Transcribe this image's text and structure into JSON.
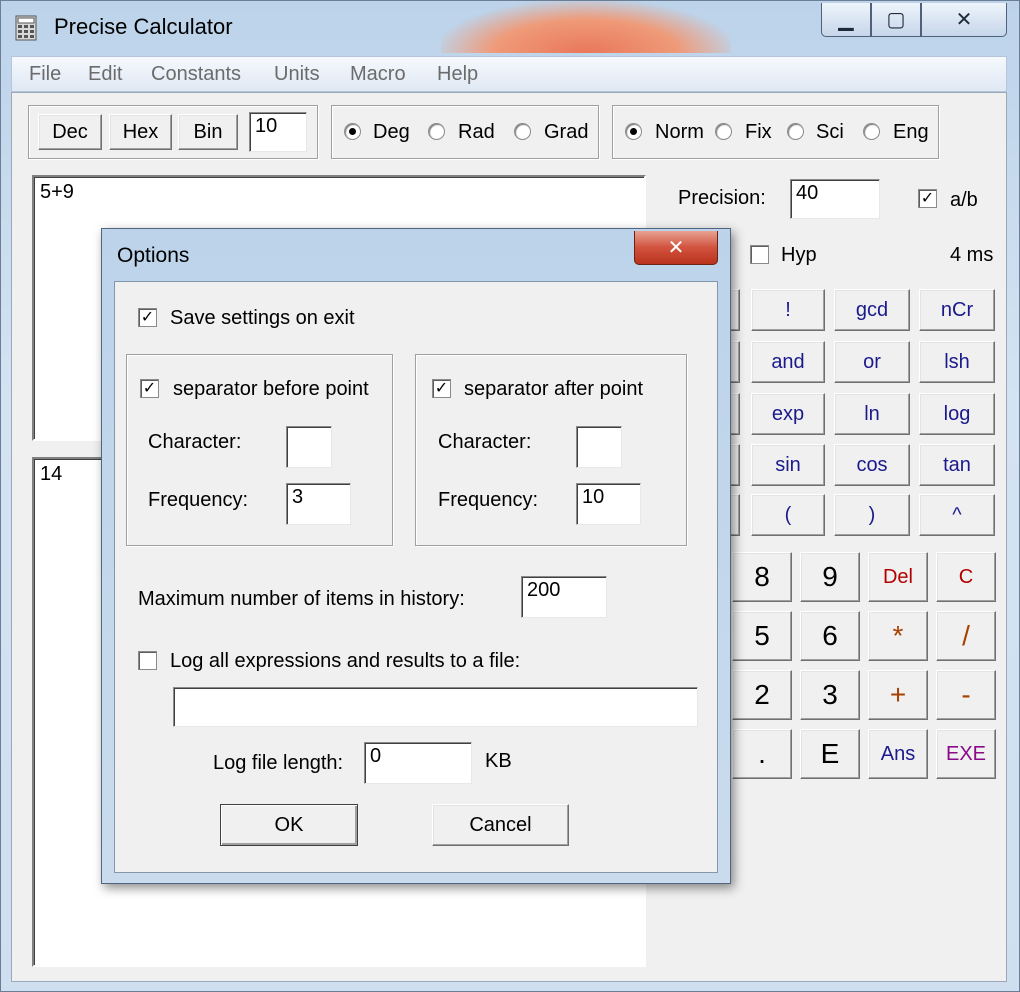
{
  "window": {
    "title": "Precise Calculator"
  },
  "caption": {
    "minimize": "▁",
    "maximize": "▢",
    "close": "✕"
  },
  "menu": [
    "File",
    "Edit",
    "Constants",
    "Units",
    "Macro",
    "Help"
  ],
  "base": {
    "dec": "Dec",
    "hex": "Hex",
    "bin": "Bin",
    "value": "10"
  },
  "angle": [
    {
      "label": "Deg",
      "selected": true
    },
    {
      "label": "Rad",
      "selected": false
    },
    {
      "label": "Grad",
      "selected": false
    }
  ],
  "format": [
    {
      "label": "Norm",
      "selected": true
    },
    {
      "label": "Fix",
      "selected": false
    },
    {
      "label": "Sci",
      "selected": false
    },
    {
      "label": "Eng",
      "selected": false
    }
  ],
  "precision": {
    "label": "Precision:",
    "value": "40"
  },
  "fraction": {
    "label": "a/b",
    "checked": true
  },
  "hyp": {
    "label": "Hyp",
    "checked": false
  },
  "timing": "4 ms",
  "expression": "5+9",
  "result": "14",
  "function_buttons": [
    "!",
    "gcd",
    "nCr",
    "and",
    "or",
    "lsh",
    "exp",
    "ln",
    "log",
    "sin",
    "cos",
    "tan",
    "(",
    ")",
    "^"
  ],
  "keypad": [
    "8",
    "9",
    "Del",
    "C",
    "5",
    "6",
    "*",
    "/",
    "2",
    "3",
    "+",
    "-",
    ".",
    "E",
    "Ans",
    "EXE"
  ],
  "dialog": {
    "title": "Options",
    "close": "✕",
    "save_settings": {
      "label": "Save settings on exit",
      "checked": true
    },
    "before_point": {
      "label": "separator before point",
      "checked": true,
      "character_label": "Character:",
      "character": "",
      "frequency_label": "Frequency:",
      "frequency": "3"
    },
    "after_point": {
      "label": "separator after point",
      "checked": true,
      "character_label": "Character:",
      "character": "",
      "frequency_label": "Frequency:",
      "frequency": "10"
    },
    "history": {
      "label": "Maximum number of items in history:",
      "value": "200"
    },
    "log": {
      "label": "Log all expressions and results to a file:",
      "checked": false,
      "path": ""
    },
    "log_length": {
      "label": "Log file length:",
      "value": "0",
      "unit": "KB"
    },
    "ok": "OK",
    "cancel": "Cancel"
  }
}
